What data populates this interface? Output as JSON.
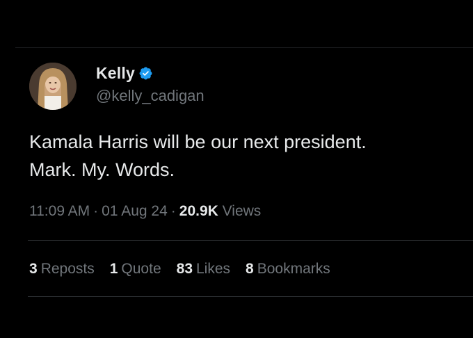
{
  "author": {
    "display_name": "Kelly",
    "handle": "@kelly_cadigan",
    "verified_icon": "verified-badge-icon",
    "verified_color": "#1d9bf0"
  },
  "tweet": {
    "lines": [
      "Kamala Harris will be our next president.",
      "Mark. My. Words."
    ]
  },
  "meta": {
    "time": "11:09 AM",
    "separator": "·",
    "date": "01 Aug 24",
    "views_count": "20.9K",
    "views_label": "Views"
  },
  "stats": {
    "reposts": {
      "count": "3",
      "label": "Reposts"
    },
    "quotes": {
      "count": "1",
      "label": "Quote"
    },
    "likes": {
      "count": "83",
      "label": "Likes"
    },
    "bookmarks": {
      "count": "8",
      "label": "Bookmarks"
    }
  },
  "colors": {
    "background": "#000000",
    "primary_text": "#e7e9ea",
    "secondary_text": "#71767b",
    "divider": "#2f3336"
  }
}
